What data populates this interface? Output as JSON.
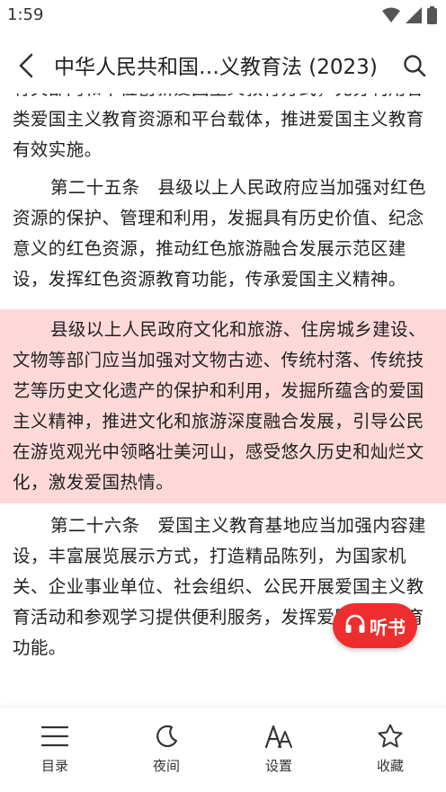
{
  "status_bar": {
    "time": "1:59",
    "icons": [
      "wifi-icon",
      "signal-icon",
      "battery-icon"
    ]
  },
  "app_bar": {
    "title": "中华人民共和国…义教育法 (2023)",
    "back_icon": "back-arrow-icon",
    "search_icon": "search-icon"
  },
  "content": {
    "partial_paragraph": "有关部门和单位创新爱国主义教育方式，充分利用各类爱国主义教育资源和平台载体，推进爱国主义教育有效实施。",
    "article_25": "第二十五条　县级以上人民政府应当加强对红色资源的保护、管理和利用，发掘具有历史价值、纪念意义的红色资源，推动红色旅游融合发展示范区建设，发挥红色资源教育功能，传承爱国主义精神。",
    "highlighted_paragraph": "县级以上人民政府文化和旅游、住房城乡建设、文物等部门应当加强对文物古迹、传统村落、传统技艺等历史文化遗产的保护和利用，发掘所蕴含的爱国主义精神，推进文化和旅游深度融合发展，引导公民在游览观光中领略壮美河山，感受悠久历史和灿烂文化，激发爱国热情。",
    "article_26": "第二十六条　爱国主义教育基地应当加强内容建设，丰富展览展示方式，打造精品陈列，为国家机关、企业事业单位、社会组织、公民开展爱国主义教育活动和参观学习提供便利服务，发挥爱国主义教育功能。",
    "highlight_color": "#ffd9d9"
  },
  "listen_button": {
    "label": "听书",
    "icon": "headphones-icon",
    "color": "#ee2e2e"
  },
  "bottom_nav": {
    "items": [
      {
        "label": "目录",
        "icon": "list-icon"
      },
      {
        "label": "夜间",
        "icon": "moon-icon"
      },
      {
        "label": "设置",
        "icon": "font-size-icon"
      },
      {
        "label": "收藏",
        "icon": "star-icon"
      }
    ]
  }
}
